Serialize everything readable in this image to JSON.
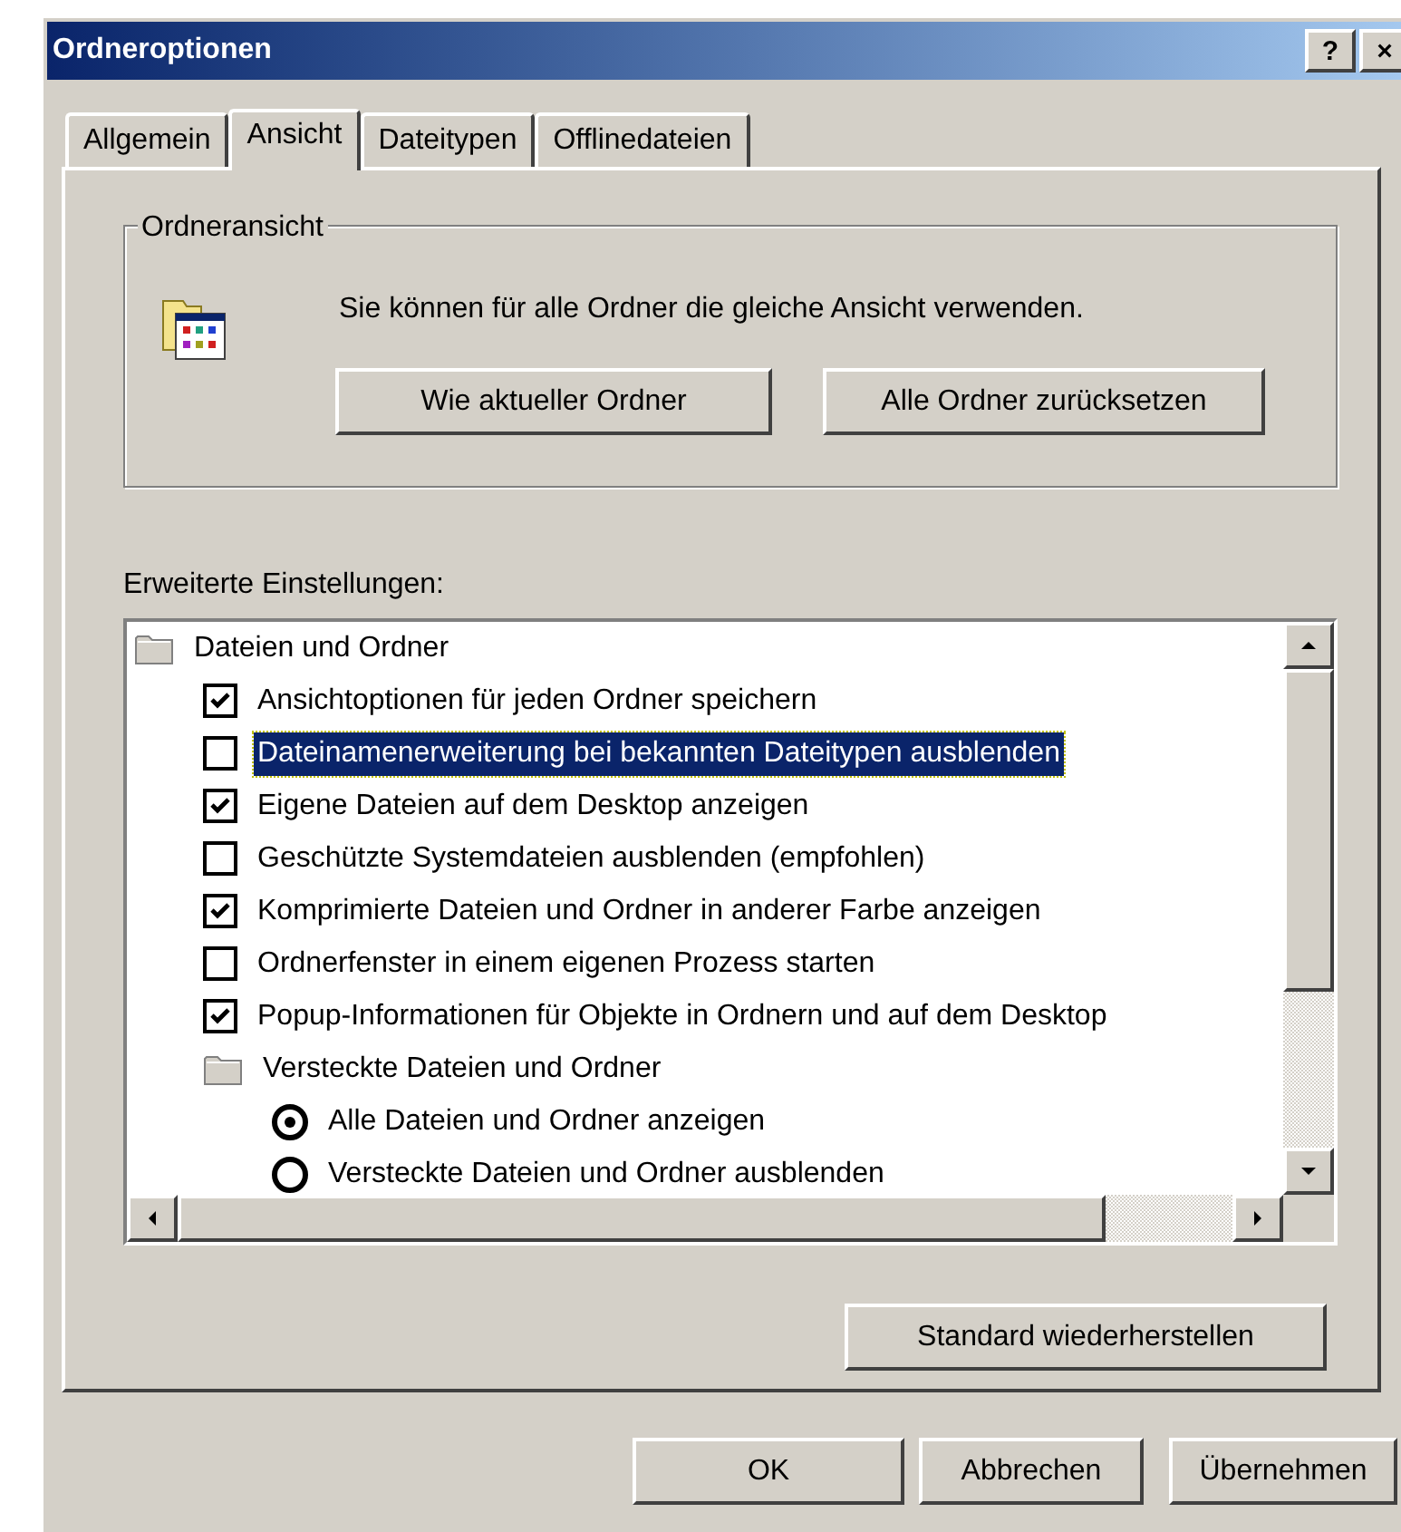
{
  "window": {
    "title": "Ordneroptionen",
    "title_buttons": [
      "?",
      "×"
    ]
  },
  "tabs": [
    {
      "label": "Allgemein",
      "selected": false
    },
    {
      "label": "Ansicht",
      "selected": true
    },
    {
      "label": "Dateitypen",
      "selected": false
    },
    {
      "label": "Offlinedateien",
      "selected": false
    }
  ],
  "folder_view": {
    "title": "Ordneransicht",
    "text": "Sie können für alle Ordner die gleiche Ansicht verwenden.",
    "buttons": [
      "Wie aktueller Ordner",
      "Alle Ordner zurücksetzen"
    ]
  },
  "advanced": {
    "label": "Erweiterte Einstellungen:",
    "items": [
      {
        "kind": "folder",
        "label": "Dateien und Ordner",
        "selected": false,
        "children": [
          {
            "kind": "checkbox",
            "label": "Ansichtoptionen für jeden Ordner speichern",
            "checked": true,
            "selected": false
          },
          {
            "kind": "checkbox",
            "label": "Dateinamenerweiterung bei bekannten Dateitypen ausblenden",
            "checked": false,
            "selected": true
          },
          {
            "kind": "checkbox",
            "label": "Eigene Dateien auf dem Desktop anzeigen",
            "checked": true,
            "selected": false
          },
          {
            "kind": "checkbox",
            "label": "Geschützte Systemdateien ausblenden (empfohlen)",
            "checked": false,
            "selected": false
          },
          {
            "kind": "checkbox",
            "label": "Komprimierte Dateien und Ordner in anderer Farbe anzeigen",
            "checked": true,
            "selected": false
          },
          {
            "kind": "checkbox",
            "label": "Ordnerfenster in einem eigenen Prozess starten",
            "checked": false,
            "selected": false
          },
          {
            "kind": "checkbox",
            "label": "Popup-Informationen für Objekte in Ordnern und auf dem Desktop",
            "checked": true,
            "selected": false
          },
          {
            "kind": "folder",
            "label": "Versteckte Dateien und Ordner",
            "selected": false,
            "children": [
              {
                "kind": "radio",
                "label": "Alle Dateien und Ordner anzeigen",
                "checked": true,
                "selected": false
              },
              {
                "kind": "radio",
                "label": "Versteckte Dateien und Ordner ausblenden",
                "checked": false,
                "selected": false
              }
            ]
          }
        ]
      }
    ],
    "restore_button": "Standard wiederherstellen"
  },
  "buttons": [
    "OK",
    "Abbrechen",
    "Übernehmen"
  ]
}
